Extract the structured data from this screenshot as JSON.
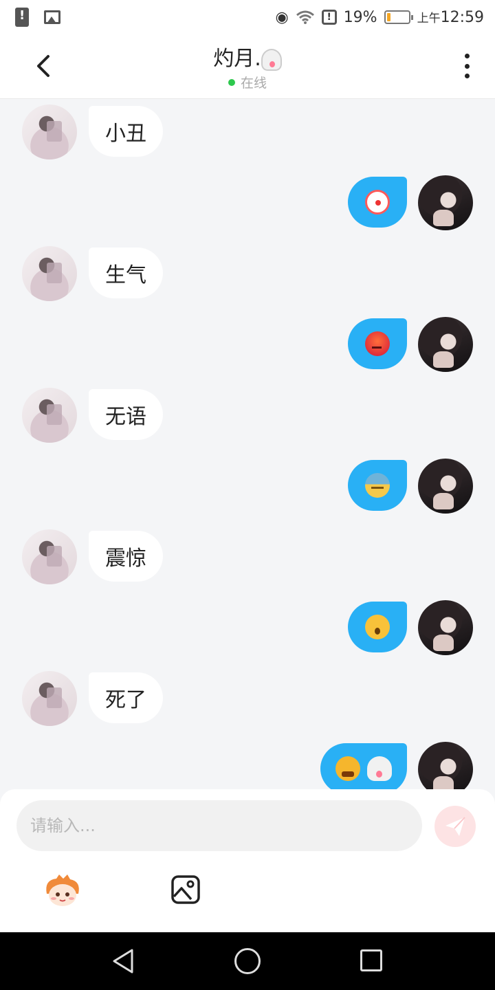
{
  "status_bar": {
    "battery_percent": "19%",
    "time_prefix": "上午",
    "time": "12:59",
    "battery_level": 0.19,
    "battery_color": "#f5a623"
  },
  "header": {
    "back_icon": "chevron-left-icon",
    "title": "灼月.",
    "title_emoji": "ghost-emoji",
    "status_text": "在线",
    "status_color": "#2dc84d",
    "more_icon": "vertical-dots-icon"
  },
  "messages": [
    {
      "side": "left",
      "text": "小丑"
    },
    {
      "side": "right",
      "emojis": [
        "clown-face-emoji"
      ]
    },
    {
      "side": "left",
      "text": "生气"
    },
    {
      "side": "right",
      "emojis": [
        "angry-face-emoji"
      ]
    },
    {
      "side": "left",
      "text": "无语"
    },
    {
      "side": "right",
      "emojis": [
        "downcast-sweat-face-emoji"
      ]
    },
    {
      "side": "left",
      "text": "震惊"
    },
    {
      "side": "right",
      "emojis": [
        "hushed-face-emoji"
      ]
    },
    {
      "side": "left",
      "text": "死了"
    },
    {
      "side": "right",
      "emojis": [
        "dizzy-face-emoji",
        "ghost-emoji"
      ]
    }
  ],
  "input": {
    "placeholder": "请输入...",
    "value": ""
  },
  "toolbar": {
    "sticker_icon": "sticker-character-icon",
    "image_icon": "image-icon",
    "send_icon": "paper-plane-icon"
  },
  "colors": {
    "bubble_right": "#29b0f5",
    "bubble_left": "#ffffff",
    "chat_background": "#f4f5f7",
    "send_button": "#fde3e4"
  }
}
